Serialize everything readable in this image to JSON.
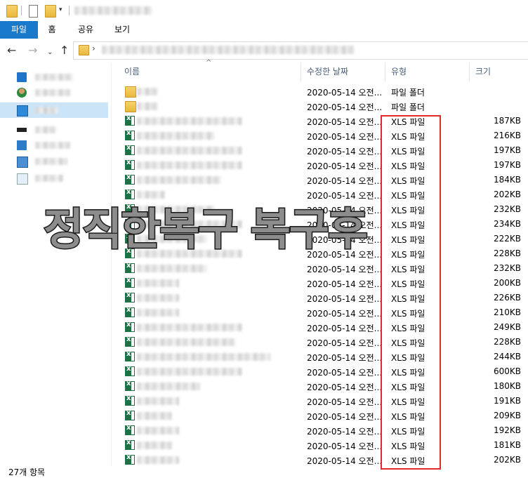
{
  "ribbon": {
    "tabs": [
      "파일",
      "홈",
      "공유",
      "보기"
    ]
  },
  "columns": {
    "name": "이름",
    "date": "수정한 날짜",
    "type": "유형",
    "size": "크기"
  },
  "rows": [
    {
      "kind": "folder",
      "date": "2020-05-14 오전...",
      "type": "파일 폴더",
      "size": ""
    },
    {
      "kind": "folder",
      "date": "2020-05-14 오전...",
      "type": "파일 폴더",
      "size": ""
    },
    {
      "kind": "xls",
      "date": "2020-05-14 오전...",
      "type": "XLS 파일",
      "size": "187KB"
    },
    {
      "kind": "xls",
      "date": "2020-05-14 오전...",
      "type": "XLS 파일",
      "size": "216KB"
    },
    {
      "kind": "xls",
      "date": "2020-05-14 오전...",
      "type": "XLS 파일",
      "size": "197KB"
    },
    {
      "kind": "xls",
      "date": "2020-05-14 오전...",
      "type": "XLS 파일",
      "size": "197KB"
    },
    {
      "kind": "xls",
      "date": "2020-05-14 오전...",
      "type": "XLS 파일",
      "size": "184KB"
    },
    {
      "kind": "xls",
      "date": "2020-05-14 오전...",
      "type": "XLS 파일",
      "size": "202KB"
    },
    {
      "kind": "xls",
      "date": "2020-05-14 오전...",
      "type": "XLS 파일",
      "size": "232KB"
    },
    {
      "kind": "xls",
      "date": "2020-05-14 오전...",
      "type": "XLS 파일",
      "size": "234KB"
    },
    {
      "kind": "xls",
      "date": "2020-05-14 오전...",
      "type": "XLS 파일",
      "size": "222KB"
    },
    {
      "kind": "xls",
      "date": "2020-05-14 오전...",
      "type": "XLS 파일",
      "size": "228KB"
    },
    {
      "kind": "xls",
      "date": "2020-05-14 오전...",
      "type": "XLS 파일",
      "size": "232KB"
    },
    {
      "kind": "xls",
      "date": "2020-05-14 오전...",
      "type": "XLS 파일",
      "size": "200KB"
    },
    {
      "kind": "xls",
      "date": "2020-05-14 오전...",
      "type": "XLS 파일",
      "size": "226KB"
    },
    {
      "kind": "xls",
      "date": "2020-05-14 오전...",
      "type": "XLS 파일",
      "size": "210KB"
    },
    {
      "kind": "xls",
      "date": "2020-05-14 오전...",
      "type": "XLS 파일",
      "size": "249KB"
    },
    {
      "kind": "xls",
      "date": "2020-05-14 오전...",
      "type": "XLS 파일",
      "size": "228KB"
    },
    {
      "kind": "xls",
      "date": "2020-05-14 오전...",
      "type": "XLS 파일",
      "size": "244KB"
    },
    {
      "kind": "xls",
      "date": "2020-05-14 오전...",
      "type": "XLS 파일",
      "size": "600KB"
    },
    {
      "kind": "xls",
      "date": "2020-05-14 오전...",
      "type": "XLS 파일",
      "size": "180KB"
    },
    {
      "kind": "xls",
      "date": "2020-05-14 오전...",
      "type": "XLS 파일",
      "size": "191KB"
    },
    {
      "kind": "xls",
      "date": "2020-05-14 오전...",
      "type": "XLS 파일",
      "size": "209KB"
    },
    {
      "kind": "xls",
      "date": "2020-05-14 오전...",
      "type": "XLS 파일",
      "size": "192KB"
    },
    {
      "kind": "xls",
      "date": "2020-05-14 오전...",
      "type": "XLS 파일",
      "size": "181KB"
    },
    {
      "kind": "xls",
      "date": "2020-05-14 오전...",
      "type": "XLS 파일",
      "size": "202KB"
    }
  ],
  "overlay_text": "정직한복구 복구후",
  "status": {
    "count": "27개 항목"
  },
  "colors": {
    "ribbon_active": "#1979ca",
    "highlight_box": "#e32a2a",
    "nav_selected": "#cce4f7"
  }
}
